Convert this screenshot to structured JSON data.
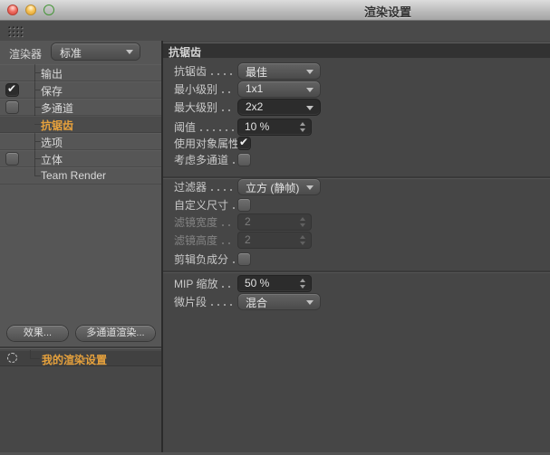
{
  "window": {
    "title": "渲染设置"
  },
  "colors": {
    "accent_orange": "#e6a13c",
    "sidebar_gray": "#565656",
    "panel_gray": "#464646",
    "header_strip": "#323232",
    "field_dark": "#2c2c2c"
  },
  "sidebar": {
    "renderer": {
      "label": "渲染器",
      "value": "标准"
    },
    "tree": [
      {
        "label": "输出"
      },
      {
        "label": "保存",
        "checked": true
      },
      {
        "label": "多通道",
        "checked": false
      },
      {
        "label": "抗锯齿",
        "selected": true
      },
      {
        "label": "选项"
      },
      {
        "label": "立体",
        "checked": false
      },
      {
        "label": "Team Render"
      }
    ],
    "buttons": {
      "effects": "效果...",
      "multipass": "多通道渲染..."
    },
    "preset": {
      "label": "我的渲染设置",
      "selected": true
    }
  },
  "main": {
    "header": "抗锯齿",
    "sections": [
      {
        "rows": [
          {
            "label": "抗锯齿",
            "type": "dropdown",
            "value": "最佳"
          },
          {
            "label": "最小级别",
            "type": "dropdown",
            "value": "1x1"
          },
          {
            "label": "最大级别",
            "type": "dropdown",
            "value": "2x2",
            "modified": true
          },
          {
            "label": "阈值",
            "type": "spinner",
            "value": "10 %"
          },
          {
            "label": "使用对象属性",
            "type": "checkbox",
            "checked": true
          },
          {
            "label": "考虑多通道",
            "type": "checkbox",
            "checked": false
          }
        ]
      },
      {
        "rows": [
          {
            "label": "过滤器",
            "type": "dropdown",
            "value": "立方 (静帧)"
          },
          {
            "label": "自定义尺寸",
            "type": "checkbox",
            "checked": false
          },
          {
            "label": "滤镜宽度",
            "type": "spinner",
            "value": "2",
            "disabled": true
          },
          {
            "label": "滤镜高度",
            "type": "spinner",
            "value": "2",
            "disabled": true
          },
          {
            "label": "剪辑负成分",
            "type": "checkbox",
            "checked": false
          }
        ]
      },
      {
        "rows": [
          {
            "label": "MIP 缩放",
            "type": "spinner",
            "value": "50 %"
          },
          {
            "label": "微片段",
            "type": "dropdown",
            "value": "混合"
          }
        ]
      }
    ]
  }
}
